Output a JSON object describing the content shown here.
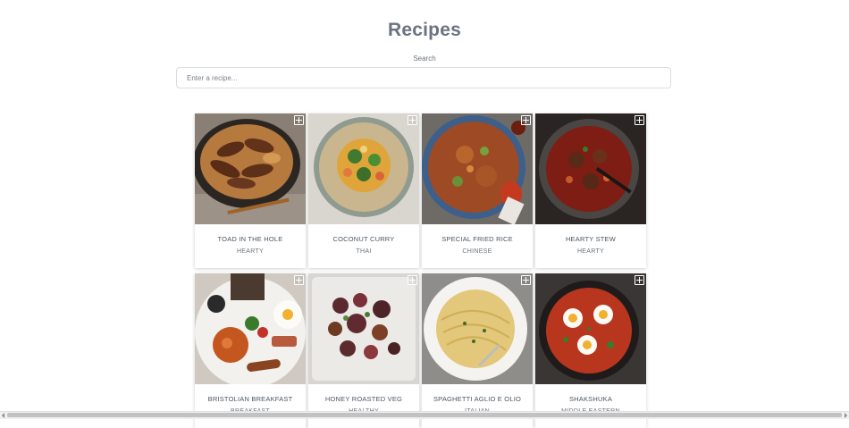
{
  "page": {
    "title": "Recipes"
  },
  "search": {
    "label": "Search",
    "placeholder": "Enter a recipe..."
  },
  "recipes": [
    {
      "name": "TOAD IN THE HOLE",
      "category": "HEARTY"
    },
    {
      "name": "COCONUT CURRY",
      "category": "THAI"
    },
    {
      "name": "SPECIAL FRIED RICE",
      "category": "CHINESE"
    },
    {
      "name": "HEARTY STEW",
      "category": "HEARTY"
    },
    {
      "name": "BRISTOLIAN BREAKFAST",
      "category": "BREAKFAST"
    },
    {
      "name": "HONEY ROASTED VEG",
      "category": "HEALTHY"
    },
    {
      "name": "SPAGHETTI AGLIO E OLIO",
      "category": "ITALIAN"
    },
    {
      "name": "SHAKSHUKA",
      "category": "MIDDLE EASTERN"
    }
  ]
}
